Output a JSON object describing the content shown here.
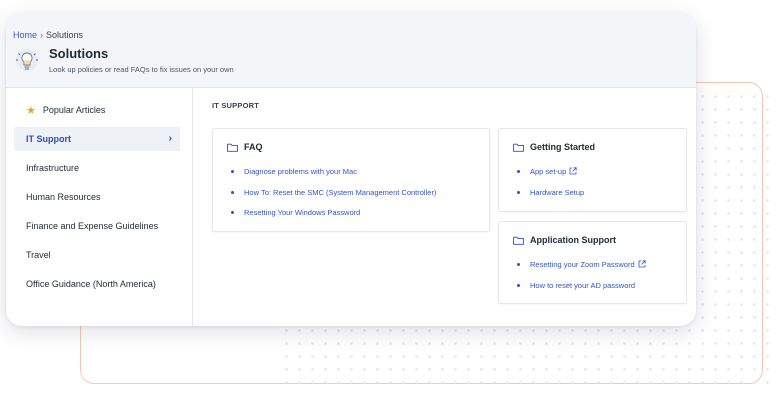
{
  "breadcrumb": {
    "home": "Home",
    "separator": "›",
    "current": "Solutions"
  },
  "header": {
    "title": "Solutions",
    "subtitle": "Look up policies or read FAQs to fix issues on your own",
    "icon": "lightbulb-icon"
  },
  "sidebar": {
    "items": [
      {
        "label": "Popular Articles",
        "icon": "star-icon"
      },
      {
        "label": "IT Support",
        "active": true
      },
      {
        "label": "Infrastructure"
      },
      {
        "label": "Human Resources"
      },
      {
        "label": "Finance and Expense Guidelines"
      },
      {
        "label": "Travel"
      },
      {
        "label": "Office Guidance (North America)"
      }
    ],
    "active_chevron": "›"
  },
  "main": {
    "section_label": "IT SUPPORT",
    "panels": [
      {
        "title": "FAQ",
        "icon": "folder-icon",
        "links": [
          {
            "label": "Diagnose problems with your Mac"
          },
          {
            "label": "How To: Reset the SMC (System Management Controller)"
          },
          {
            "label": "Resetting Your Windows Password"
          }
        ]
      },
      {
        "title": "Getting Started",
        "icon": "folder-icon",
        "links": [
          {
            "label": "App set-up",
            "external": true
          },
          {
            "label": "Hardware Setup"
          }
        ]
      },
      {
        "title": "Application Support",
        "icon": "folder-icon",
        "links": [
          {
            "label": "Resetting your Zoom Password",
            "external": true
          },
          {
            "label": "How to reset your AD password"
          }
        ]
      }
    ]
  },
  "colors": {
    "accent": "#2b4ec2",
    "link": "#2f55c8",
    "star": "#f0a032",
    "frame": "#f6c6b2",
    "header_bg": "#f3f5f8"
  }
}
